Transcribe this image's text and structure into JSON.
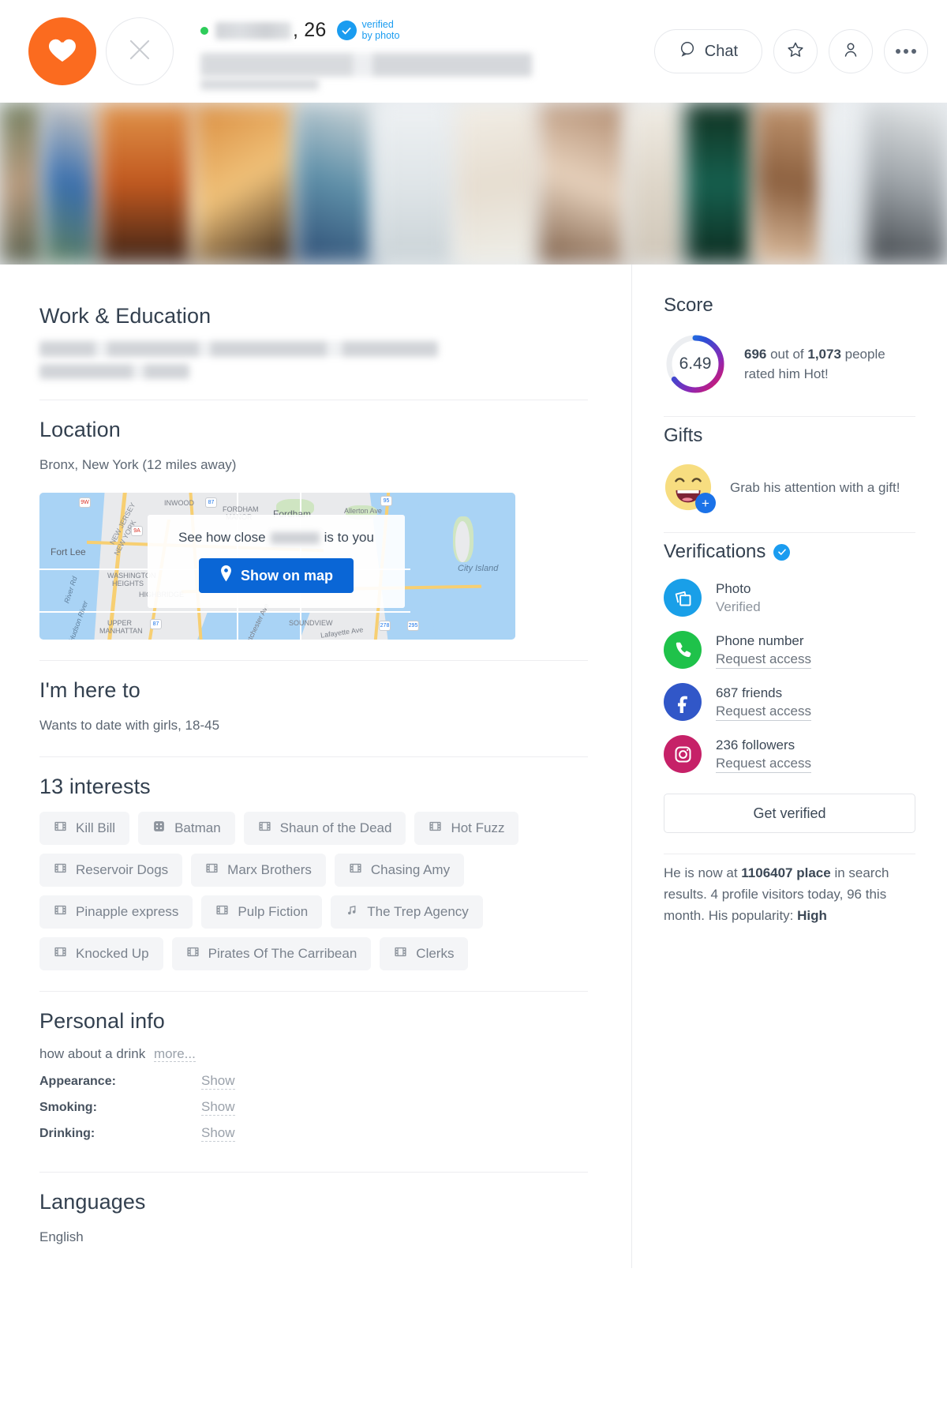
{
  "header": {
    "like_icon": "heart-icon",
    "skip_icon": "close-icon",
    "age": ", 26",
    "verified_line1": "verified",
    "verified_line2": "by photo",
    "chat_label": "Chat",
    "favorite_icon": "star-icon",
    "profile_icon": "person-icon",
    "more_icon": "more-dots-icon"
  },
  "left": {
    "work_education": {
      "title": "Work & Education"
    },
    "location": {
      "title": "Location",
      "value": "Bronx, New York (12 miles away)",
      "overlay_prefix": "See how close",
      "overlay_suffix": "is to you",
      "show_on_map": "Show on map",
      "map_labels": [
        "INWOOD",
        "FORDHAM MANOR",
        "Fordham",
        "Allerton Ave",
        "City Island",
        "Fort Lee",
        "NEW JERSEY",
        "NEW YORK",
        "WASHINGTON HEIGHTS",
        "HIGHBRIDGE",
        "UPPER MANHATTAN",
        "SOUNDVIEW",
        "Lafayette Ave",
        "River Rd",
        "Hudson River",
        "9W",
        "9A",
        "87",
        "95",
        "278",
        "295"
      ]
    },
    "here_to": {
      "title": "I'm here to",
      "value": "Wants to date with girls, 18-45"
    },
    "interests": {
      "title": "13 interests",
      "items": [
        {
          "label": "Kill Bill",
          "icon": "film-icon"
        },
        {
          "label": "Batman",
          "icon": "game-icon"
        },
        {
          "label": "Shaun of the Dead",
          "icon": "film-icon"
        },
        {
          "label": "Hot Fuzz",
          "icon": "film-icon"
        },
        {
          "label": "Reservoir Dogs",
          "icon": "film-icon"
        },
        {
          "label": "Marx Brothers",
          "icon": "film-icon"
        },
        {
          "label": "Chasing Amy",
          "icon": "film-icon"
        },
        {
          "label": "Pinapple express",
          "icon": "film-icon"
        },
        {
          "label": "Pulp Fiction",
          "icon": "film-icon"
        },
        {
          "label": "The Trep Agency",
          "icon": "music-icon"
        },
        {
          "label": "Knocked Up",
          "icon": "film-icon"
        },
        {
          "label": "Pirates Of The Carribean",
          "icon": "film-icon"
        },
        {
          "label": "Clerks",
          "icon": "film-icon"
        }
      ]
    },
    "personal_info": {
      "title": "Personal info",
      "about": "how about a drink",
      "more_label": "more...",
      "rows": [
        {
          "key": "Appearance:",
          "value": "Show"
        },
        {
          "key": "Smoking:",
          "value": "Show"
        },
        {
          "key": "Drinking:",
          "value": "Show"
        }
      ]
    },
    "languages": {
      "title": "Languages",
      "value": "English"
    }
  },
  "right": {
    "score": {
      "title": "Score",
      "value": "6.49",
      "rated_count": "696",
      "rated_mid": " out of ",
      "rated_total": "1,073",
      "rated_tail": " people rated him Hot!",
      "percent": 64.9
    },
    "gifts": {
      "title": "Gifts",
      "text": "Grab his attention with a gift!",
      "emoji_icon": "laughing-face-icon",
      "plus_icon": "plus-icon"
    },
    "verifications": {
      "title": "Verifications",
      "items": [
        {
          "icon": "photo-icon",
          "color": "#199fe8",
          "title": "Photo",
          "status": "Verified",
          "link": null
        },
        {
          "icon": "phone-icon",
          "color": "#1fc24a",
          "title": "Phone number",
          "status": null,
          "link": "Request access"
        },
        {
          "icon": "facebook-icon",
          "color": "#3157c8",
          "title": "687 friends",
          "status": null,
          "link": "Request access"
        },
        {
          "icon": "instagram-icon",
          "color": "#c62168",
          "title": "236 followers",
          "status": null,
          "link": "Request access"
        }
      ],
      "get_verified_label": "Get verified"
    },
    "popularity": {
      "pre": "He is now at ",
      "place": "1106407 place",
      "mid": " in search results. 4 profile visitors today, 96 this month. His popularity: ",
      "level": "High"
    }
  },
  "colors": {
    "accent_orange": "#fb6b1f",
    "accent_blue": "#0a66d6",
    "verified_blue": "#1a9cf0",
    "online_green": "#2ecc5a"
  }
}
